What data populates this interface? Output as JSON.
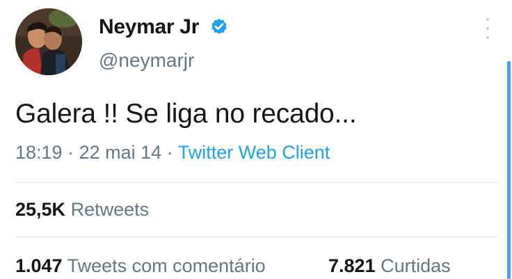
{
  "profile": {
    "display_name": "Neymar Jr",
    "handle": "@neymarjr",
    "verified": true
  },
  "tweet": {
    "text": "Galera !! Se liga no recado...",
    "time": "18:19",
    "separator1": "·",
    "date": "22 mai 14",
    "separator2": "·",
    "client": "Twitter Web Client"
  },
  "stats": {
    "retweets_count": "25,5K",
    "retweets_label": "Retweets",
    "quote_count": "1.047",
    "quote_label": "Tweets com comentário",
    "likes_count": "7.821",
    "likes_label": "Curtidas"
  },
  "icons": {
    "verified": "verified-badge-icon",
    "more": "more-vertical-icon"
  },
  "colors": {
    "link_blue": "#1da1f2",
    "muted_text": "#657786",
    "text": "#14171a",
    "divider": "#e3e8ec",
    "scroll_accent": "#46a3e8"
  }
}
